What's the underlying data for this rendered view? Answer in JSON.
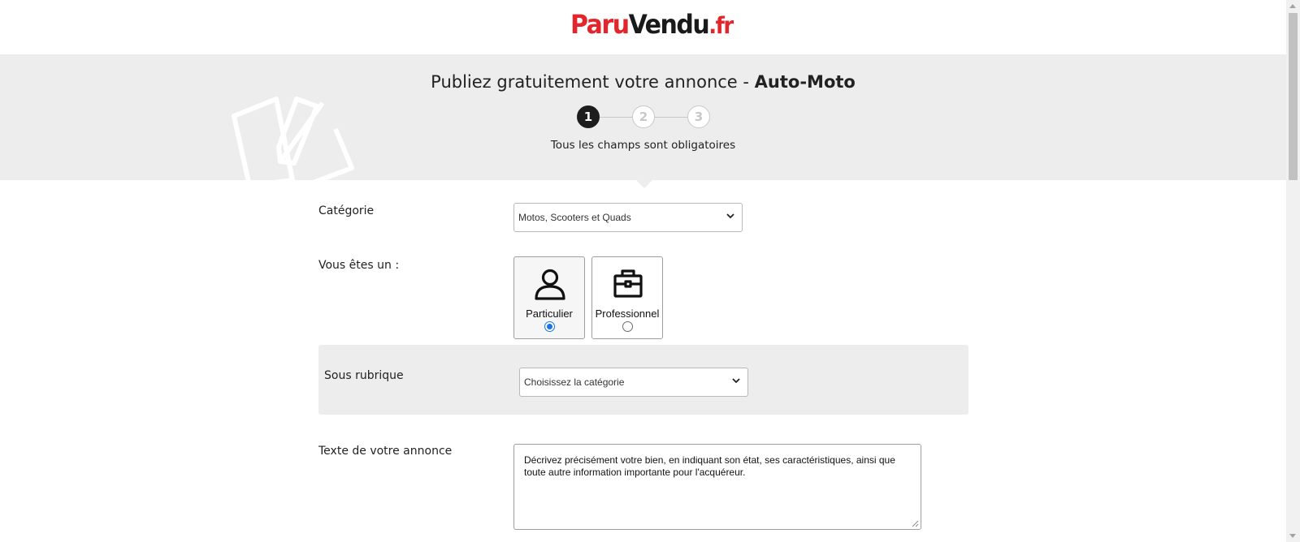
{
  "header": {
    "logo_part1": "Paru",
    "logo_part2": "Vendu",
    "logo_part3": ".fr"
  },
  "banner": {
    "title_prefix": "Publiez gratuitement votre annonce - ",
    "title_bold": "Auto-Moto",
    "subtitle": "Tous les champs sont obligatoires",
    "steps": [
      {
        "label": "1",
        "active": true
      },
      {
        "label": "2",
        "active": false
      },
      {
        "label": "3",
        "active": false
      }
    ]
  },
  "form": {
    "category": {
      "label": "Catégorie",
      "value": "Motos, Scooters et Quads"
    },
    "seller_type": {
      "label": "Vous êtes un :",
      "options": [
        {
          "label": "Particulier",
          "icon": "person-icon",
          "selected": true
        },
        {
          "label": "Professionnel",
          "icon": "briefcase-icon",
          "selected": false
        }
      ]
    },
    "sub_rubric": {
      "label": "Sous rubrique",
      "value": "Choisissez la catégorie"
    },
    "ad_text": {
      "label": "Texte de votre annonce",
      "placeholder": "Décrivez précisément votre bien, en indiquant son état, ses caractéristiques, ainsi que toute autre information importante pour l'acquéreur."
    }
  },
  "colors": {
    "brand_red": "#e3262b",
    "banner_bg": "#ededed",
    "step_active": "#1d1d1d",
    "radio_blue": "#1b74e4"
  }
}
